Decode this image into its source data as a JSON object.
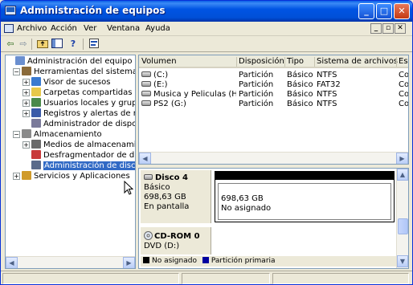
{
  "window": {
    "title": "Administración de equipos",
    "minimize": "_",
    "maximize": "□",
    "close": "✕"
  },
  "menubar": {
    "items": [
      "Archivo",
      "Acción",
      "Ver",
      "Ventana",
      "Ayuda"
    ],
    "mdi": [
      "_",
      "▫",
      "✕"
    ]
  },
  "toolbar": {
    "icons": [
      "back-arrow-icon",
      "forward-arrow-icon",
      "up-folder-icon",
      "show-hide-tree-icon",
      "help-icon",
      "properties-icon"
    ]
  },
  "tree": {
    "items": [
      {
        "label": "Administración del equipo (loca",
        "icon": "computer-icon",
        "indent": 0,
        "expander": ""
      },
      {
        "label": "Herramientas del sistema",
        "icon": "tools-icon",
        "indent": 1,
        "expander": "−"
      },
      {
        "label": "Visor de sucesos",
        "icon": "event-viewer-icon",
        "indent": 2,
        "expander": "+"
      },
      {
        "label": "Carpetas compartidas",
        "icon": "shared-folders-icon",
        "indent": 2,
        "expander": "+"
      },
      {
        "label": "Usuarios locales y grupc",
        "icon": "users-icon",
        "indent": 2,
        "expander": "+"
      },
      {
        "label": "Registros y alertas de re",
        "icon": "performance-logs-icon",
        "indent": 2,
        "expander": "+"
      },
      {
        "label": "Administrador de dispos",
        "icon": "device-manager-icon",
        "indent": 2,
        "expander": ""
      },
      {
        "label": "Almacenamiento",
        "icon": "storage-icon",
        "indent": 1,
        "expander": "−"
      },
      {
        "label": "Medios de almacenamie",
        "icon": "removable-storage-icon",
        "indent": 2,
        "expander": "+"
      },
      {
        "label": "Desfragmentador de dis",
        "icon": "defrag-icon",
        "indent": 2,
        "expander": ""
      },
      {
        "label": "Administración de disco",
        "icon": "disk-management-icon",
        "indent": 2,
        "expander": "",
        "selected": true
      },
      {
        "label": "Servicios y Aplicaciones",
        "icon": "services-icon",
        "indent": 1,
        "expander": "+"
      }
    ]
  },
  "volume_list": {
    "columns": [
      "Volumen",
      "Disposición",
      "Tipo",
      "Sistema de archivos",
      "Es"
    ],
    "rows": [
      {
        "volume": "(C:)",
        "layout": "Partición",
        "type": "Básico",
        "fs": "NTFS",
        "status": "Co"
      },
      {
        "volume": "(E:)",
        "layout": "Partición",
        "type": "Básico",
        "fs": "FAT32",
        "status": "Co"
      },
      {
        "volume": "Musica y Peliculas (H:)",
        "layout": "Partición",
        "type": "Básico",
        "fs": "NTFS",
        "status": "Co"
      },
      {
        "volume": "PS2 (G:)",
        "layout": "Partición",
        "type": "Básico",
        "fs": "NTFS",
        "status": "Co"
      }
    ]
  },
  "graphical_view": {
    "disks": [
      {
        "name": "Disco 4",
        "type": "Básico",
        "size": "698,63 GB",
        "status": "En pantalla",
        "volume_size": "698,63 GB",
        "volume_status": "No asignado"
      },
      {
        "name": "CD-ROM 0",
        "type": "DVD (D:)"
      }
    ],
    "legend": [
      {
        "label": "No asignado",
        "color": "#000000"
      },
      {
        "label": "Partición primaria",
        "color": "#0000a0"
      }
    ]
  },
  "colors": {
    "title_bar": "#0054e3",
    "selection": "#316ac5",
    "unallocated": "#000000",
    "primary_partition": "#0000a0"
  }
}
